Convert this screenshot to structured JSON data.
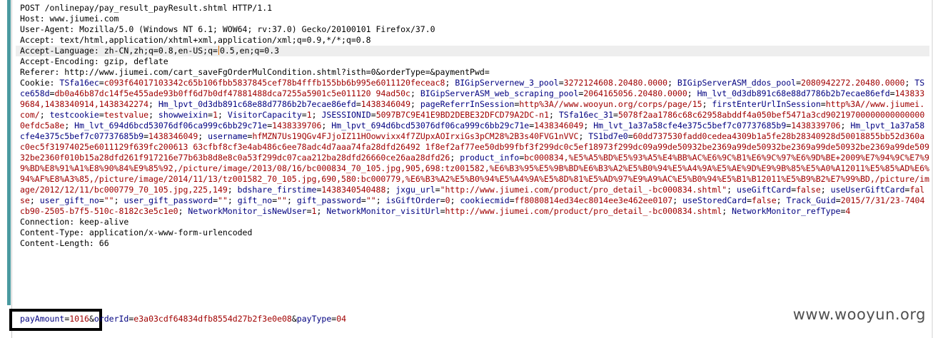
{
  "headers_top": [
    "POST /onlinepay/pay_result_payResult.shtml HTTP/1.1",
    "Host: www.jiumei.com",
    "User-Agent: Mozilla/5.0 (Windows NT 6.1; WOW64; rv:37.0) Gecko/20100101 Firefox/37.0",
    "Accept: text/html,application/xhtml+xml,application/xml;q=0.9,*/*;q=0.8"
  ],
  "accept_language": {
    "before": "Accept-Language: zh-CN,zh;q=0.8,en-US;q=",
    "after": "0.5,en;q=0.3"
  },
  "headers_mid": [
    "Accept-Encoding: gzip, deflate",
    "Referer: http://www.jiumei.com/cart_saveFgOrderMulCondition.shtml?isth=0&orderType=&paymentPwd="
  ],
  "cookie_label": "Cookie: ",
  "cookies": [
    {
      "k": "TSfa16ec",
      "v": "c093f64017103342c65b106fbb5837845cef78b4fffb155bb6b995e6011120feceac8"
    },
    {
      "k": "BIGipServernew_3_pool",
      "v": "3272124608.20480.0000"
    },
    {
      "k": "BIGipServerASM_ddos_pool",
      "v": "2080942272.20480.0000"
    },
    {
      "k": "TSce658d",
      "v": "db0a46b87dc14f5e455ade93b0ff6d7b0df47881488dca7255a5901c5e011120 94ad50c"
    },
    {
      "k": "BIGipServerASM_web_scraping_pool",
      "v": "2064165056.20480.0000"
    },
    {
      "k": "Hm_lvt_0d3db891c68e88d7786b2b7ecae86efd",
      "v": "1438339684,1438340914,1438342274"
    },
    {
      "k": "Hm_lpvt_0d3db891c68e88d7786b2b7ecae86efd",
      "v": "1438346049"
    },
    {
      "k": "pageReferrInSession",
      "v": "http%3A//www.wooyun.org/corps/page/15"
    },
    {
      "k": "firstEnterUrlInSession",
      "v": "http%3A//www.jiumei.com/"
    },
    {
      "k": "testcookie",
      "v": "testvalue"
    },
    {
      "k": "showweixin",
      "v": "1"
    },
    {
      "k": "VisitorCapacity",
      "v": "1"
    },
    {
      "k": "JSESSIONID",
      "v": "5097B7C9E41E9BD2DEBE32DFCD79A2DC-n1"
    },
    {
      "k": "TSfa16ec_31",
      "v": "5078f2aa1786c68c62958abddf4a050bef5471a3cd902197000000000000000efdc5a8e"
    },
    {
      "k": "Hm_lvt_694d6bcd53076df06ca999c6bb29c71e",
      "v": "1438339706"
    },
    {
      "k": "Hm_lpvt_694d6bcd53076df06ca999c6bb29c71e",
      "v": "1438346049"
    },
    {
      "k": "Hm_lvt_1a37a58cfe4e375c5bef7c07737685b9",
      "v": "1438339706"
    },
    {
      "k": "Hm_lpvt_1a37a58cfe4e375c5bef7c07737685b9",
      "v": "1438346049"
    },
    {
      "k": "username",
      "v": "hfMZN7Us19QGv4FJjoIZ11HOowvixx4f7ZUpxAOIrxiGs3pCM28%2B3s40FVG1nVVC"
    },
    {
      "k": "TS1bd7e0",
      "v": "60dd737530fadd0cedea4309b1a5fe28b28340928d50018855bb52d360ac0ec5f31974025e6011129f639fc200613 63cfbf8cf3e4ab486c6ee78adc4d7aaa74fa28dfd26492 1f8ef2af77ee50db99fbf3f299dc0c5ef18973f299dc09a99de50932be2369a99de50932be2369a99de50932be2369a99de50932be2360f010b15a28dfd261f917216e77b63b8d8e8c0a53f299dc07caa212ba28dfd26660ce26aa28dfd26"
    },
    {
      "k": "product_info",
      "v": "bc000834,%E5%A5%BD%E5%93%A5%E4%BB%AC%E6%9C%B1%E6%9C%97%E6%9D%BE+2009%E7%94%9C%E7%99%BD%E8%91%A1%E8%90%84%E9%85%92,/picture/image/2013/08/16/bc000834_70_105.jpg,905,698:tz001582,%E6%B3%95%E5%9B%BD%E6%B3%A2%E5%B0%94%E5%A4%9A%E5%AE%9D%E9%9B%85%E5%A0%A12011%E5%85%AD%E6%94%AF%E8%A3%85,/picture/image/2014/11/13/tz001582_70_105.jpg,690,580:bc000779,%E6%B3%A2%E5%B0%94%E5%A4%9A%E5%8D%81%E5%AD%97%E9%A9%AC%E5%B0%94%E5%B1%B12011%E5%B9%B2%E7%99%BD,/picture/image/2012/12/11/bc000779_70_105.jpg,225,149"
    },
    {
      "k": "bdshare_firstime",
      "v": "1438340540488"
    },
    {
      "k": "jxgu_url",
      "v": "\"http://www.jiumei.com/product/pro_detail_-bc000834.shtml\""
    },
    {
      "k": "useGiftCard",
      "v": "false"
    },
    {
      "k": "useUserGiftCard",
      "v": "false"
    },
    {
      "k": "user_gift_no",
      "v": "\"\""
    },
    {
      "k": "user_gift_password",
      "v": "\"\""
    },
    {
      "k": "gift_no",
      "v": "\"\""
    },
    {
      "k": "gift_password",
      "v": "\"\""
    },
    {
      "k": "isGiftOrder",
      "v": "0"
    },
    {
      "k": "cookiecmid",
      "v": "ff8080814ed34ec8014ee3e462ee0107"
    },
    {
      "k": "useStoredCard",
      "v": "false"
    },
    {
      "k": "Track_Guid",
      "v": "2015/7/31/23-7404cb90-2505-b7f5-510c-8182c3e5c1e0"
    },
    {
      "k": "NetworkMonitor_isNewUser",
      "v": "1"
    },
    {
      "k": "NetworkMonitor_visitUrl",
      "v": "http://www.jiumei.com/product/pro_detail_-bc000834.shtml"
    },
    {
      "k": "NetworkMonitor_refType",
      "v": "4"
    }
  ],
  "headers_bottom": [
    "Connection: keep-alive",
    "Content-Type: application/x-www-form-urlencoded",
    "Content-Length: 66"
  ],
  "body_params": [
    {
      "k": "payAmount",
      "v": "1016"
    },
    {
      "k": "orderId",
      "v": "e3a03cdf64834dfb8554d27b2f3e0e08"
    },
    {
      "k": "payType",
      "v": "04"
    }
  ],
  "watermark": "www.wooyun.org"
}
